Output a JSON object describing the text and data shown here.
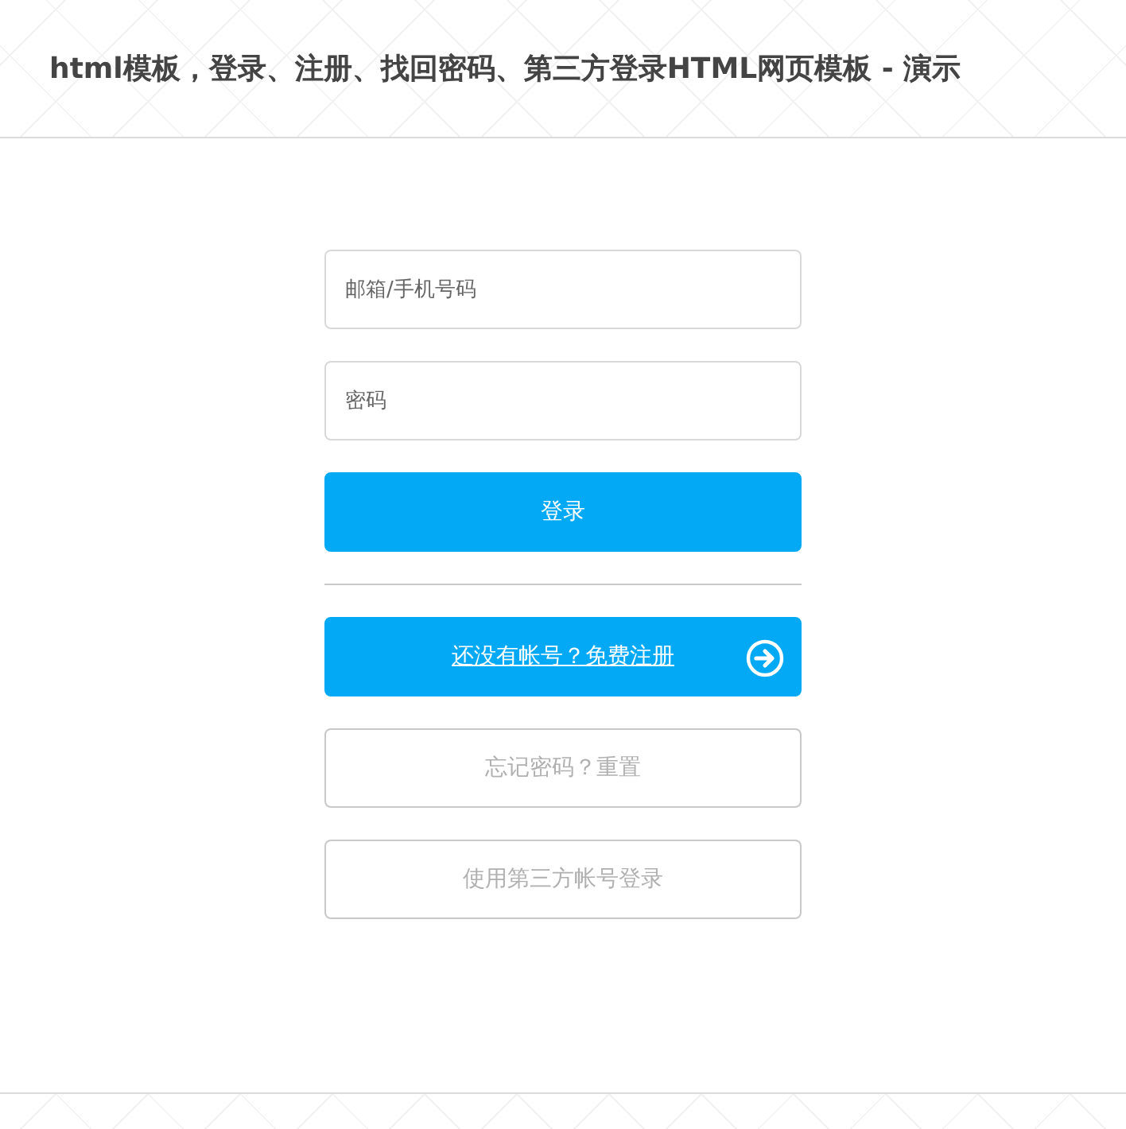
{
  "header": {
    "title": "html模板，登录、注册、找回密码、第三方登录HTML网页模板 - 演示"
  },
  "fields": [
    {
      "placeholder": "邮箱/手机号码"
    },
    {
      "placeholder": "密码"
    }
  ],
  "login_button": {
    "label": "登录"
  },
  "actions": [
    {
      "label": "还没有帐号？免费注册",
      "kind": "primary"
    },
    {
      "label": "忘记密码？重置",
      "kind": "outline"
    },
    {
      "label": "使用第三方帐号登录",
      "kind": "outline"
    }
  ]
}
